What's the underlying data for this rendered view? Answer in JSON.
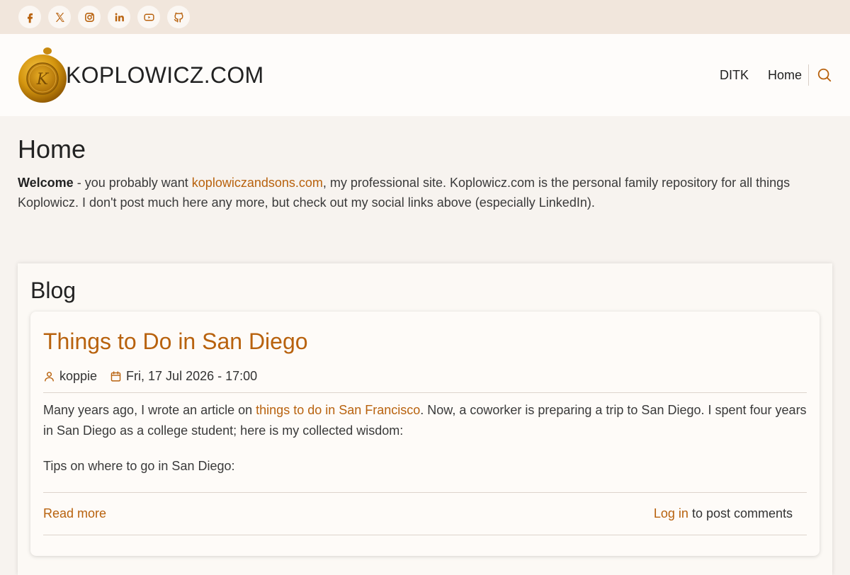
{
  "social": [
    {
      "name": "facebook-icon",
      "label": "Facebook"
    },
    {
      "name": "x-icon",
      "label": "X"
    },
    {
      "name": "instagram-icon",
      "label": "Instagram"
    },
    {
      "name": "linkedin-icon",
      "label": "LinkedIn"
    },
    {
      "name": "youtube-icon",
      "label": "YouTube"
    },
    {
      "name": "github-icon",
      "label": "GitHub"
    }
  ],
  "header": {
    "site_name": "KOPLOWICZ.COM",
    "logo_icon": "wax-seal-logo",
    "nav": [
      {
        "label": "DITK"
      },
      {
        "label": "Home"
      }
    ],
    "search_icon": "search-icon"
  },
  "page": {
    "title": "Home",
    "intro": {
      "bold": "Welcome",
      "before_link": " - you probably want ",
      "link": "koplowiczandsons.com",
      "after_link": ", my professional site.  Koplowicz.com is the personal family repository for all things Koplowicz.  I don't post much here any more, but check out my social links above (especially LinkedIn)."
    }
  },
  "blog": {
    "title": "Blog",
    "article": {
      "title": "Things to Do in San Diego",
      "author": "koppie",
      "date": "Fri, 17 Jul 2026 - 17:00",
      "p1_before": "Many years ago, I wrote an article on ",
      "p1_link": "things to do in San Francisco",
      "p1_after": ".  Now, a coworker is preparing a trip to San Diego.  I spent four years in San Diego as a college student; here is my collected wisdom:",
      "p2": "Tips on where to go in San Diego:",
      "read_more": "Read more",
      "login": "Log in",
      "comments_suffix": " to post comments"
    }
  },
  "colors": {
    "accent": "#b8620e",
    "topbar": "#f1e6dc",
    "background": "#f7f3ef"
  }
}
